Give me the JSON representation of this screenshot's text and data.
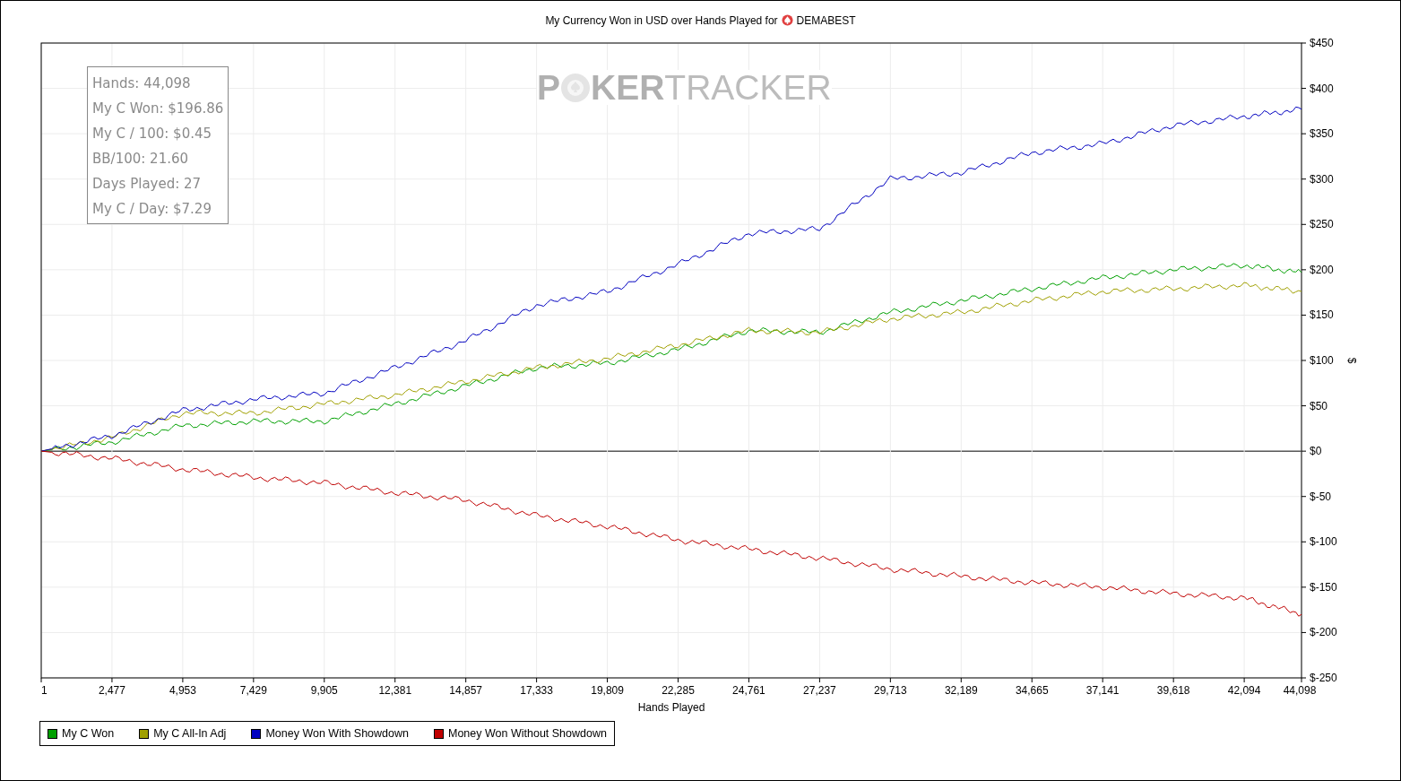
{
  "title": {
    "prefix": "My Currency Won in USD over Hands Played for",
    "player": "DEMABEST"
  },
  "watermark": {
    "left": "P",
    "middle": "KER",
    "right": "TRACKER"
  },
  "stats": [
    "Hands: 44,098",
    "My C Won: $196.86",
    "My C / 100: $0.45",
    "BB/100: 21.60",
    "Days Played: 27",
    "My C / Day: $7.29"
  ],
  "chart_data": {
    "type": "line",
    "grid": true,
    "xlabel": "Hands Played",
    "ylabel": "$",
    "x": [
      1,
      2477,
      4953,
      7429,
      9905,
      12381,
      14857,
      17333,
      19809,
      22285,
      24761,
      27237,
      29713,
      32189,
      34665,
      37141,
      39618,
      42094,
      44098
    ],
    "xlim": [
      1,
      44098
    ],
    "ylim": [
      -250,
      450
    ],
    "xticks": [
      {
        "value": 1,
        "label": "1"
      },
      {
        "value": 2477,
        "label": "2,477"
      },
      {
        "value": 4953,
        "label": "4,953"
      },
      {
        "value": 7429,
        "label": "7,429"
      },
      {
        "value": 9905,
        "label": "9,905"
      },
      {
        "value": 12381,
        "label": "12,381"
      },
      {
        "value": 14857,
        "label": "14,857"
      },
      {
        "value": 17333,
        "label": "17,333"
      },
      {
        "value": 19809,
        "label": "19,809"
      },
      {
        "value": 22285,
        "label": "22,285"
      },
      {
        "value": 24761,
        "label": "24,761"
      },
      {
        "value": 27237,
        "label": "27,237"
      },
      {
        "value": 29713,
        "label": "29,713"
      },
      {
        "value": 32189,
        "label": "32,189"
      },
      {
        "value": 34665,
        "label": "34,665"
      },
      {
        "value": 37141,
        "label": "37,141"
      },
      {
        "value": 39618,
        "label": "39,618"
      },
      {
        "value": 42094,
        "label": "42,094"
      },
      {
        "value": 44098,
        "label": "44,098"
      }
    ],
    "yticks": [
      {
        "value": 450,
        "label": "$450"
      },
      {
        "value": 400,
        "label": "$400"
      },
      {
        "value": 350,
        "label": "$350"
      },
      {
        "value": 300,
        "label": "$300"
      },
      {
        "value": 250,
        "label": "$250"
      },
      {
        "value": 200,
        "label": "$200"
      },
      {
        "value": 150,
        "label": "$150"
      },
      {
        "value": 100,
        "label": "$100"
      },
      {
        "value": 50,
        "label": "$50"
      },
      {
        "value": 0,
        "label": "$0"
      },
      {
        "value": -50,
        "label": "$-50"
      },
      {
        "value": -100,
        "label": "$-100"
      },
      {
        "value": -150,
        "label": "$-150"
      },
      {
        "value": -200,
        "label": "$-200"
      },
      {
        "value": -250,
        "label": "$-250"
      }
    ],
    "series": [
      {
        "name": "My C Won",
        "color": "#00a000",
        "values": [
          0,
          10,
          28,
          33,
          33,
          52,
          72,
          92,
          97,
          112,
          133,
          131,
          153,
          166,
          179,
          191,
          200,
          205,
          197
        ]
      },
      {
        "name": "My C All-In Adj",
        "color": "#a0a000",
        "values": [
          0,
          15,
          42,
          42,
          52,
          62,
          77,
          92,
          102,
          117,
          133,
          131,
          146,
          153,
          166,
          176,
          179,
          183,
          176
        ]
      },
      {
        "name": "Money Won With Showdown",
        "color": "#0000c0",
        "values": [
          0,
          17,
          45,
          57,
          64,
          92,
          122,
          161,
          176,
          206,
          240,
          245,
          300,
          307,
          329,
          339,
          359,
          369,
          377
        ]
      },
      {
        "name": "Money Won Without Showdown",
        "color": "#c00000",
        "values": [
          0,
          -8,
          -20,
          -29,
          -35,
          -46,
          -54,
          -71,
          -83,
          -98,
          -108,
          -118,
          -130,
          -138,
          -145,
          -150,
          -157,
          -162,
          -180
        ]
      }
    ]
  }
}
